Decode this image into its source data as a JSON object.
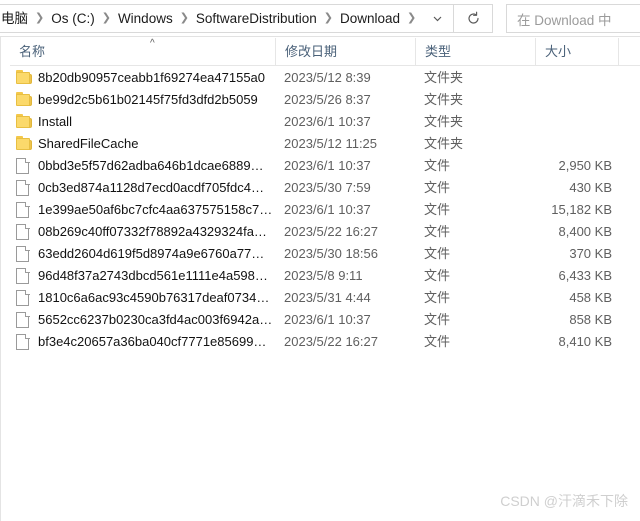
{
  "addressbar": {
    "breadcrumbs": [
      {
        "label": "电脑"
      },
      {
        "label": "Os (C:)"
      },
      {
        "label": "Windows"
      },
      {
        "label": "SoftwareDistribution"
      },
      {
        "label": "Download"
      }
    ],
    "separator": "❯",
    "dropdown_icon": "chevron-down-icon",
    "refresh_icon": "refresh-icon",
    "refresh_glyph": "↻",
    "chevron_glyph": "⌄"
  },
  "search": {
    "placeholder": "在 Download 中",
    "value": ""
  },
  "columns": {
    "name": "名称",
    "date_modified": "修改日期",
    "type": "类型",
    "size": "大小",
    "sort_caret": "^"
  },
  "files": [
    {
      "icon": "folder-icon",
      "name": "8b20db90957ceabb1f69274ea47155a0",
      "date": "2023/5/12 8:39",
      "type": "文件夹",
      "size": ""
    },
    {
      "icon": "folder-icon",
      "name": "be99d2c5b61b02145f75fd3dfd2b5059",
      "date": "2023/5/26 8:37",
      "type": "文件夹",
      "size": ""
    },
    {
      "icon": "folder-icon",
      "name": "Install",
      "date": "2023/6/1 10:37",
      "type": "文件夹",
      "size": ""
    },
    {
      "icon": "folder-icon",
      "name": "SharedFileCache",
      "date": "2023/5/12 11:25",
      "type": "文件夹",
      "size": ""
    },
    {
      "icon": "file-icon",
      "name": "0bbd3e5f57d62adba646b1dcae6889…",
      "date": "2023/6/1 10:37",
      "type": "文件",
      "size": "2,950 KB"
    },
    {
      "icon": "file-icon",
      "name": "0cb3ed874a1128d7ecd0acdf705fdc4…",
      "date": "2023/5/30 7:59",
      "type": "文件",
      "size": "430 KB"
    },
    {
      "icon": "file-icon",
      "name": "1e399ae50af6bc7cfc4aa637575158c7…",
      "date": "2023/6/1 10:37",
      "type": "文件",
      "size": "15,182 KB"
    },
    {
      "icon": "file-icon",
      "name": "08b269c40ff07332f78892a4329324fa…",
      "date": "2023/5/22 16:27",
      "type": "文件",
      "size": "8,400 KB"
    },
    {
      "icon": "file-icon",
      "name": "63edd2604d619f5d8974a9e6760a77…",
      "date": "2023/5/30 18:56",
      "type": "文件",
      "size": "370 KB"
    },
    {
      "icon": "file-icon",
      "name": "96d48f37a2743dbcd561e1111e4a598…",
      "date": "2023/5/8 9:11",
      "type": "文件",
      "size": "6,433 KB"
    },
    {
      "icon": "file-icon",
      "name": "1810c6a6ac93c4590b76317deaf0734…",
      "date": "2023/5/31 4:44",
      "type": "文件",
      "size": "458 KB"
    },
    {
      "icon": "file-icon",
      "name": "5652cc6237b0230ca3fd4ac003f6942a…",
      "date": "2023/6/1 10:37",
      "type": "文件",
      "size": "858 KB"
    },
    {
      "icon": "file-icon",
      "name": "bf3e4c20657a36ba040cf7771e85699…",
      "date": "2023/5/22 16:27",
      "type": "文件",
      "size": "8,410 KB"
    }
  ],
  "watermark": {
    "text": "CSDN @汗滴禾下除"
  }
}
